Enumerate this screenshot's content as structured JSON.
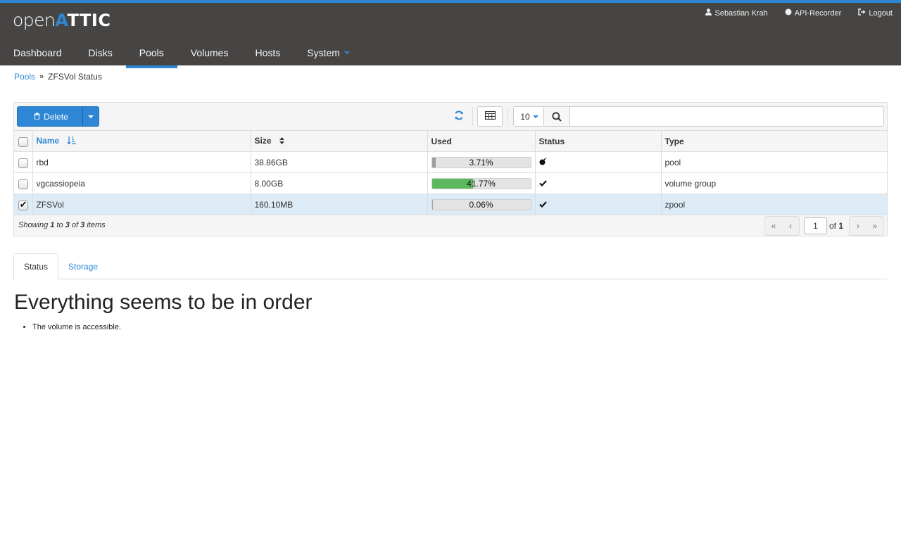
{
  "logo": {
    "open": "open",
    "a": "A",
    "ttic": "TTIC"
  },
  "user_nav": {
    "user": "Sebastian Krah",
    "recorder": "API-Recorder",
    "logout": "Logout"
  },
  "nav": {
    "dashboard": "Dashboard",
    "disks": "Disks",
    "pools": "Pools",
    "volumes": "Volumes",
    "hosts": "Hosts",
    "system": "System"
  },
  "breadcrumb": {
    "parent": "Pools",
    "current": "ZFSVol Status"
  },
  "toolbar": {
    "delete_label": "Delete",
    "page_size": "10",
    "search_value": ""
  },
  "table": {
    "headers": {
      "name": "Name",
      "size": "Size",
      "used": "Used",
      "status": "Status",
      "type": "Type"
    },
    "rows": [
      {
        "name": "rbd",
        "size": "38.86GB",
        "used_label": "3.71%",
        "used_fraction": 0.0371,
        "used_color": "#9e9e9e",
        "status_icon": "bomb-icon",
        "type": "pool",
        "selected": false
      },
      {
        "name": "vgcassiopeia",
        "size": "8.00GB",
        "used_label": "41.77%",
        "used_fraction": 0.4177,
        "used_color": "#5cb85c",
        "status_icon": "check-icon",
        "type": "volume group",
        "selected": false
      },
      {
        "name": "ZFSVol",
        "size": "160.10MB",
        "used_label": "0.06%",
        "used_fraction": 0.0006,
        "used_color": "#9e9e9e",
        "status_icon": "check-icon",
        "type": "zpool",
        "selected": true
      }
    ]
  },
  "footer": {
    "showing": "Showing",
    "from": "1",
    "to_word": "to",
    "to": "3",
    "of_word": "of",
    "total": "3",
    "items": "items",
    "page": "1",
    "pages_of": "of",
    "pages_total": "1"
  },
  "tabs": {
    "status": "Status",
    "storage": "Storage"
  },
  "status_panel": {
    "heading": "Everything seems to be in order",
    "messages": [
      "The volume is accessible."
    ]
  },
  "colors": {
    "accent": "#2e86d6",
    "topbar": "#474544",
    "selected_row": "#dcebf6"
  }
}
